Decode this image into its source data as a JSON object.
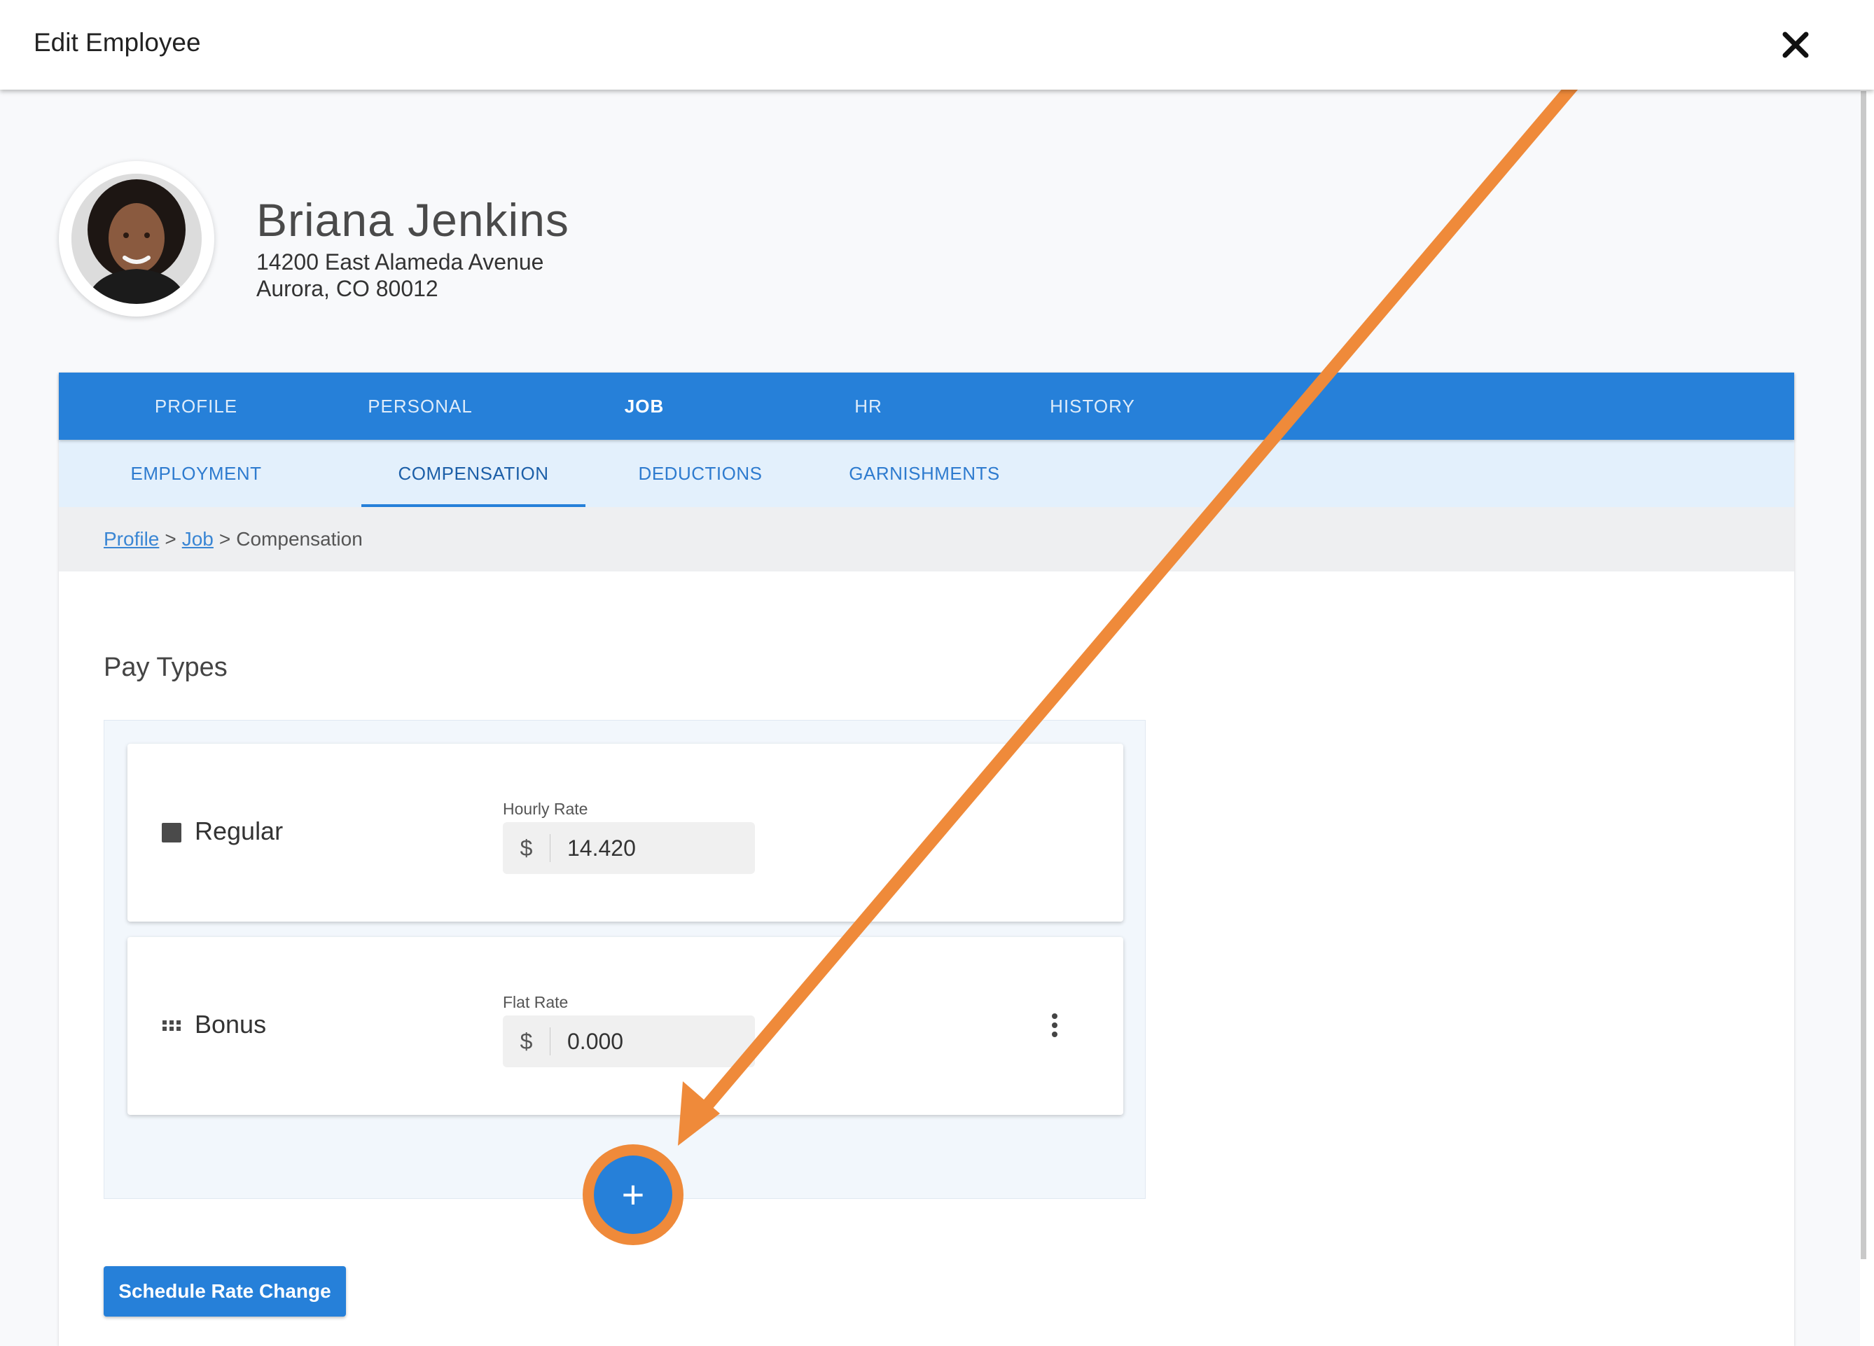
{
  "window": {
    "title": "Edit Employee"
  },
  "employee": {
    "name": "Briana Jenkins",
    "address_line1": "14200 East Alameda Avenue",
    "address_line2": "Aurora, CO 80012"
  },
  "tabs": {
    "primary": [
      {
        "label": "PROFILE"
      },
      {
        "label": "PERSONAL"
      },
      {
        "label": "JOB",
        "active": true
      },
      {
        "label": "HR"
      },
      {
        "label": "HISTORY"
      }
    ],
    "secondary": [
      {
        "label": "EMPLOYMENT"
      },
      {
        "label": "COMPENSATION",
        "active": true
      },
      {
        "label": "DEDUCTIONS"
      },
      {
        "label": "GARNISHMENTS"
      }
    ]
  },
  "breadcrumb": {
    "items": [
      "Profile",
      "Job",
      "Compensation"
    ],
    "separator": ">"
  },
  "pay_types": {
    "title": "Pay Types",
    "items": [
      {
        "name": "Regular",
        "rate_label": "Hourly Rate",
        "currency": "$",
        "value": "14.420",
        "icon": "square-icon"
      },
      {
        "name": "Bonus",
        "rate_label": "Flat Rate",
        "currency": "$",
        "value": "0.000",
        "icon": "grid-dots-icon"
      }
    ],
    "add_label": "+"
  },
  "actions": {
    "schedule_rate_change": "Schedule Rate Change"
  },
  "colors": {
    "primary": "#2680d9",
    "secondary_tab_bg": "#e3f0fc",
    "annotation": "#ef8a3a"
  }
}
